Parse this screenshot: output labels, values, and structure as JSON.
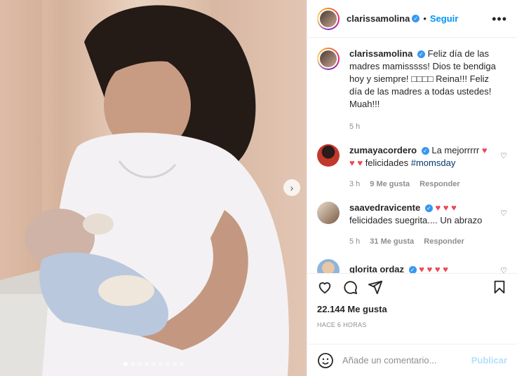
{
  "header": {
    "username": "clarissamolina",
    "separator": "•",
    "follow_label": "Seguir",
    "more_label": "•••"
  },
  "caption": {
    "username": "clarissamolina",
    "text": "Feliz día de las madres mamisssss! Dios te bendiga hoy y siempre! □□□□ Reina!!! Feliz día de las madres a todas ustedes! Muah!!!",
    "time": "5 h"
  },
  "comments": [
    {
      "username": "zumayacordero",
      "text_a": "La mejorrrrr",
      "hearts_a": "♥",
      "hearts_b": "♥ ♥",
      "text_b": "felicidades",
      "hashtag": "#momsday",
      "time": "3 h",
      "likes": "9 Me gusta",
      "reply": "Responder"
    },
    {
      "username": "saavedravicente",
      "hearts": "♥ ♥ ♥",
      "text": "felicidades suegrita.... Un abrazo",
      "time": "5 h",
      "likes": "31 Me gusta",
      "reply": "Responder"
    },
    {
      "username": "glorita ordaz",
      "username_display": "glorita ordaz",
      "hearts": "♥ ♥ ♥ ♥"
    }
  ],
  "likes_text": "22.144 Me gusta",
  "posted": "HACE 6 HORAS",
  "add_comment": {
    "placeholder": "Añade un comentario...",
    "publish": "Publicar"
  },
  "carousel": {
    "count": 9,
    "active": 0
  },
  "colors": {
    "link": "#0095f6",
    "verified": "#3897f0",
    "heart": "#ed4956"
  }
}
